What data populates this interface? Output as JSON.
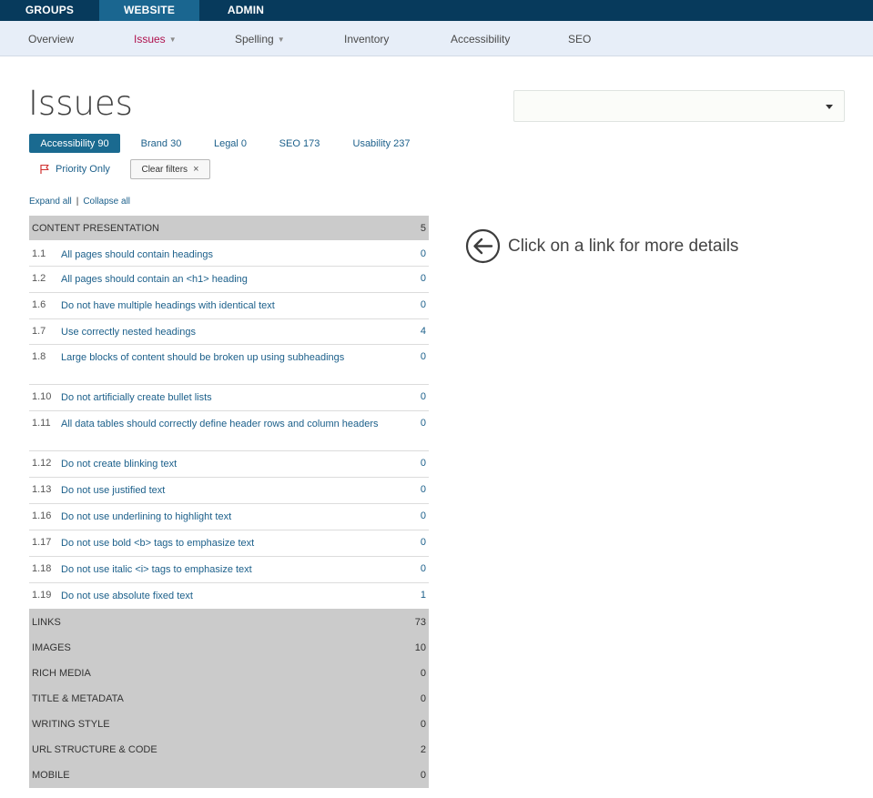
{
  "top_nav": [
    {
      "label": "GROUPS",
      "active": false
    },
    {
      "label": "WEBSITE",
      "active": true
    },
    {
      "label": "ADMIN",
      "active": false
    }
  ],
  "sub_nav": [
    {
      "label": "Overview",
      "active": false,
      "dropdown": false
    },
    {
      "label": "Issues",
      "active": true,
      "dropdown": true
    },
    {
      "label": "Spelling",
      "active": false,
      "dropdown": true
    },
    {
      "label": "Inventory",
      "active": false,
      "dropdown": false
    },
    {
      "label": "Accessibility",
      "active": false,
      "dropdown": false
    },
    {
      "label": "SEO",
      "active": false,
      "dropdown": false
    }
  ],
  "page_title": "Issues",
  "site_select": {
    "value": ""
  },
  "categories": [
    {
      "label": "Accessibility 90",
      "active": true
    },
    {
      "label": "Brand 30",
      "active": false
    },
    {
      "label": "Legal 0",
      "active": false
    },
    {
      "label": "SEO 173",
      "active": false
    },
    {
      "label": "Usability 237",
      "active": false
    }
  ],
  "filters": {
    "priority_label": "Priority Only",
    "clear_label": "Clear filters",
    "clear_icon": "×"
  },
  "expand": {
    "expand_all": "Expand all",
    "separator": "|",
    "collapse_all": "Collapse all"
  },
  "groups": [
    {
      "title": "CONTENT PRESENTATION",
      "count": "5",
      "expanded": true,
      "items": [
        {
          "num": "1.1",
          "label": "All pages should contain headings",
          "count": "0"
        },
        {
          "num": "1.2",
          "label": "All pages should contain an <h1> heading",
          "count": "0"
        },
        {
          "num": "1.6",
          "label": "Do not have multiple headings with identical text",
          "count": "0"
        },
        {
          "num": "1.7",
          "label": "Use correctly nested headings",
          "count": "4"
        },
        {
          "num": "1.8",
          "label": "Large blocks of content should be broken up using subheadings",
          "count": "0"
        },
        {
          "num": "1.10",
          "label": "Do not artificially create bullet lists",
          "count": "0"
        },
        {
          "num": "1.11",
          "label": "All data tables should correctly define header rows and column headers",
          "count": "0"
        },
        {
          "num": "1.12",
          "label": "Do not create blinking text",
          "count": "0"
        },
        {
          "num": "1.13",
          "label": "Do not use justified text",
          "count": "0"
        },
        {
          "num": "1.16",
          "label": "Do not use underlining to highlight text",
          "count": "0"
        },
        {
          "num": "1.17",
          "label": "Do not use bold <b> tags to emphasize text",
          "count": "0"
        },
        {
          "num": "1.18",
          "label": "Do not use italic <i> tags to emphasize text",
          "count": "0"
        },
        {
          "num": "1.19",
          "label": "Do not use absolute fixed text",
          "count": "1"
        }
      ]
    },
    {
      "title": "LINKS",
      "count": "73",
      "expanded": false,
      "items": []
    },
    {
      "title": "IMAGES",
      "count": "10",
      "expanded": false,
      "items": []
    },
    {
      "title": "RICH MEDIA",
      "count": "0",
      "expanded": false,
      "items": []
    },
    {
      "title": "TITLE & METADATA",
      "count": "0",
      "expanded": false,
      "items": []
    },
    {
      "title": "WRITING STYLE",
      "count": "0",
      "expanded": false,
      "items": []
    },
    {
      "title": "URL STRUCTURE & CODE",
      "count": "2",
      "expanded": false,
      "items": []
    },
    {
      "title": "MOBILE",
      "count": "0",
      "expanded": false,
      "items": []
    }
  ],
  "details_hint": {
    "icon": "arrow-left-circle-icon",
    "text": "Click on a link for more details"
  },
  "colors": {
    "top_nav_bg": "#073a5c",
    "top_nav_active": "#1a6690",
    "sub_nav_bg": "#e7eef8",
    "active_sub_nav": "#b0124e",
    "link": "#1b5f8a",
    "group_bg": "#cbcbcb",
    "active_category": "#1a6a90"
  }
}
